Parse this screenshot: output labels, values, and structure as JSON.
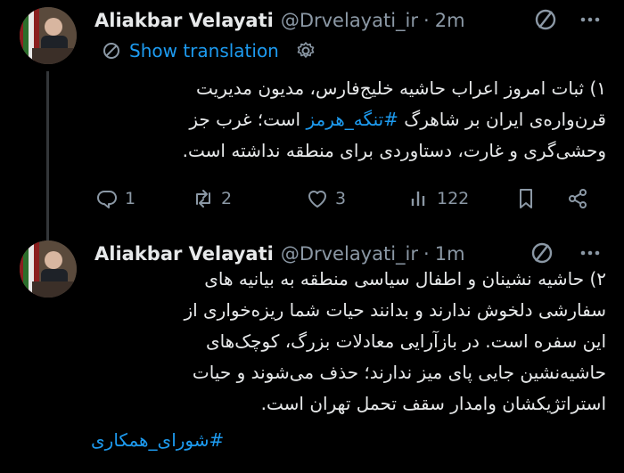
{
  "tweets": [
    {
      "name": "Aliakbar Velayati",
      "handle": "@Drvelayati_ir",
      "separator": "·",
      "time": "2m",
      "translation_label": "Show translation",
      "body_prefix": "۱) ثبات امروز اعراب حاشیه خلیج‌فارس، مدیون مدیریت قرن‌واره‌ی ایران بر شاهرگ ",
      "hashtag": "#تنگه_هرمز",
      "body_suffix": " است؛ غرب جز وحشی‌گری و غارت، دستاوردی برای منطقه نداشته است.",
      "lines": [
        "۱) ثبات امروز اعراب حاشیه خلیج‌فارس، مدیون مدیریت",
        "قرن‌واره‌ی ایران بر شاهرگ #تنگه_هرمز است؛ غرب جز",
        "وحشی‌گری و غارت، دستاوردی برای منطقه نداشته است."
      ],
      "stats": {
        "replies": "1",
        "reposts": "2",
        "likes": "3",
        "views": "122"
      }
    },
    {
      "name": "Aliakbar Velayati",
      "handle": "@Drvelayati_ir",
      "separator": "·",
      "time": "1m",
      "lines": [
        "۲) حاشیه نشینان و اطفال سیاسی منطقه به بیانیه های",
        "سفارشی دلخوش ندارند و بدانند حیات شما ریزه‌خواری از",
        "این سفره است. در بازآرایی معادلات بزرگ، کوچک‌های",
        "حاشیه‌نشین جایی پای میز ندارند؛ حذف می‌شوند و حیات",
        "استراتژیکشان وامدار سقف تحمل تهران است."
      ],
      "hashtag": "#شورای_همکاری"
    }
  ],
  "colors": {
    "background": "#000000",
    "text": "#e7e9ea",
    "muted": "#8b98a5",
    "link": "#1d9bf0"
  },
  "icons": [
    "grok-icon",
    "more-icon",
    "translate-icon",
    "gear-icon",
    "reply-icon",
    "repost-icon",
    "like-icon",
    "views-icon",
    "bookmark-icon",
    "share-icon"
  ]
}
